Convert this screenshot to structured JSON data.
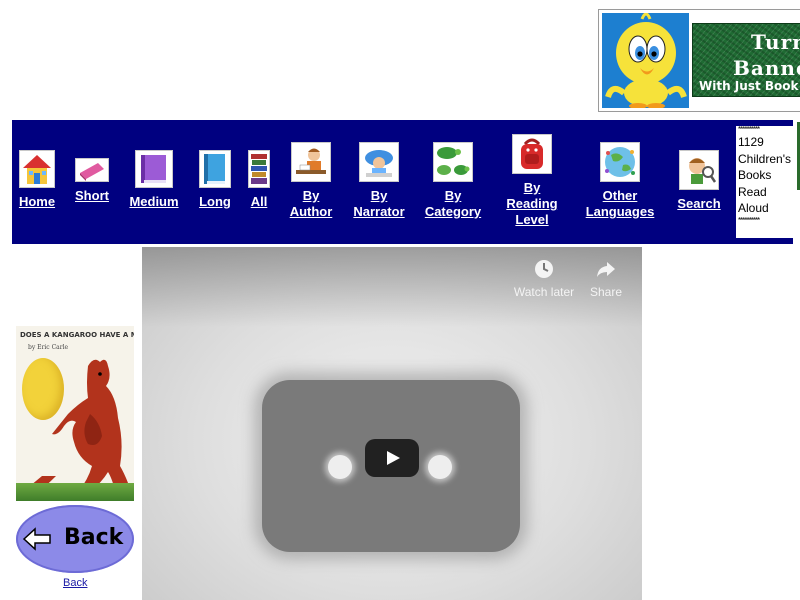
{
  "banner": {
    "line1": "Turn",
    "line2": "Banne",
    "subtitle": "With Just Book"
  },
  "nav": {
    "items": [
      {
        "label_lines": [
          "Home"
        ],
        "icon": "house-icon"
      },
      {
        "label_lines": [
          "Short"
        ],
        "icon": "pink-book-icon"
      },
      {
        "label_lines": [
          "Medium"
        ],
        "icon": "purple-book-icon"
      },
      {
        "label_lines": [
          "Long"
        ],
        "icon": "blue-book-icon"
      },
      {
        "label_lines": [
          "All"
        ],
        "icon": "book-stack-icon"
      },
      {
        "label_lines": [
          "By",
          "Author"
        ],
        "icon": "author-writing-icon"
      },
      {
        "label_lines": [
          "By",
          "Narrator"
        ],
        "icon": "narrator-icon"
      },
      {
        "label_lines": [
          "By",
          "Category"
        ],
        "icon": "turtles-icon"
      },
      {
        "label_lines": [
          "By",
          "Reading",
          "Level"
        ],
        "icon": "backpack-icon"
      },
      {
        "label_lines": [
          "Other",
          "Languages"
        ],
        "icon": "globe-people-icon"
      },
      {
        "label_lines": [
          "Search"
        ],
        "icon": "magnifier-kid-icon"
      }
    ],
    "stats": {
      "stars_top": "**********",
      "line1": "1129",
      "line2": "Children's",
      "line3": "Books",
      "line4": "Read",
      "line5": "Aloud",
      "stars_bottom": "**********"
    }
  },
  "book": {
    "cover_title": "DOES A KANGAROO HAVE A MOTHER, TOO?",
    "cover_author": "by Eric Carle"
  },
  "back": {
    "button_text": "Back",
    "link_text": "Back"
  },
  "video": {
    "watch_later_label": "Watch later",
    "share_label": "Share"
  },
  "colors": {
    "nav_background": "#000080",
    "page_background": "#ffffff",
    "back_button": "#8c8ae8",
    "link": "#1a1aa6"
  }
}
